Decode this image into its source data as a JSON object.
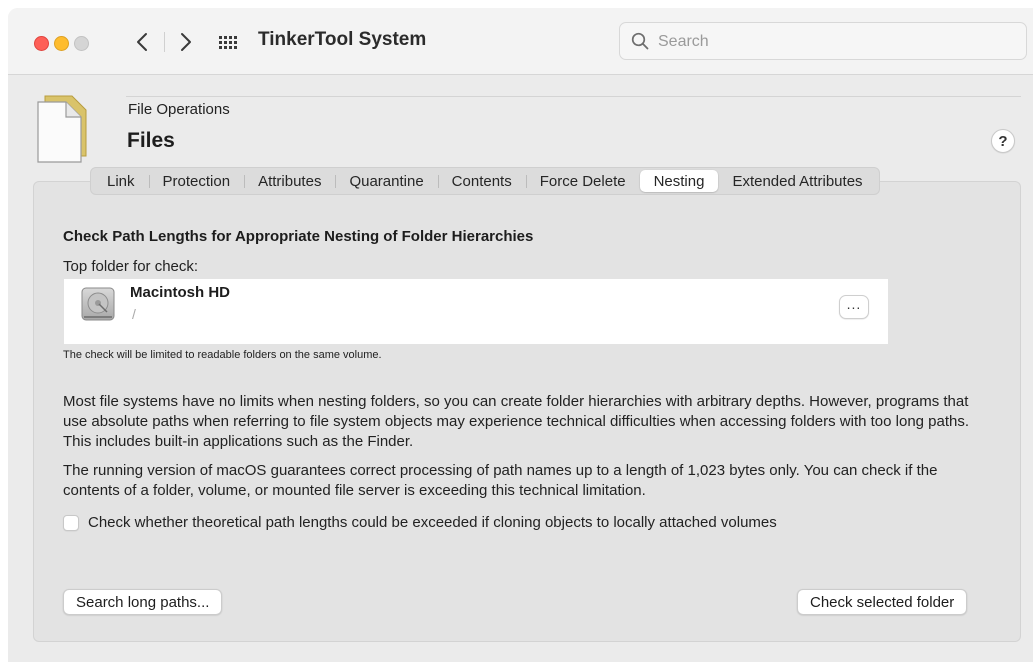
{
  "window": {
    "app_title": "TinkerTool System",
    "search_placeholder": "Search"
  },
  "pane": {
    "section": "File Operations",
    "title": "Files",
    "help_label": "?"
  },
  "tabs": [
    {
      "label": "Link",
      "active": false
    },
    {
      "label": "Protection",
      "active": false
    },
    {
      "label": "Attributes",
      "active": false
    },
    {
      "label": "Quarantine",
      "active": false
    },
    {
      "label": "Contents",
      "active": false
    },
    {
      "label": "Force Delete",
      "active": false
    },
    {
      "label": "Nesting",
      "active": true
    },
    {
      "label": "Extended Attributes",
      "active": false
    }
  ],
  "nesting": {
    "heading": "Check Path Lengths for Appropriate Nesting of Folder Hierarchies",
    "top_folder_label": "Top folder for check:",
    "volume_name": "Macintosh HD",
    "volume_path": "/",
    "more_label": "...",
    "note": "The check will be limited to readable folders on the same volume.",
    "paragraph1": "Most file systems have no limits when nesting folders, so you can create folder hierarchies with arbitrary depths. However, programs that use absolute paths when referring to file system objects may experience technical difficulties when accessing folders with too long paths. This includes built-in applications such as the Finder.",
    "paragraph2": "The running version of macOS guarantees correct processing of path names up to a length of 1,023 bytes only. You can check if the contents of a folder, volume, or mounted file server is exceeding this technical limitation.",
    "checkbox_label": "Check whether theoretical path lengths could be exceeded if cloning objects to locally attached volumes",
    "checkbox_checked": false,
    "search_button": "Search long paths...",
    "check_button": "Check selected folder"
  },
  "colors": {
    "close": "#fe5f57",
    "minimize": "#febc2e",
    "zoom_inactive": "#d5d5d5"
  }
}
